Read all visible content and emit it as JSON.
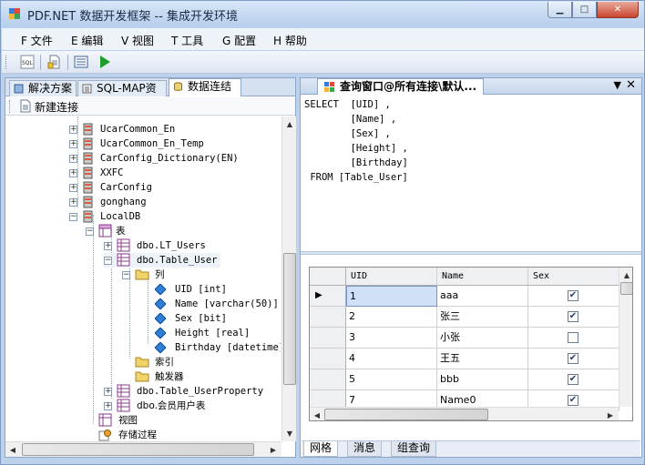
{
  "window": {
    "title": "PDF.NET 数据开发框架 -- 集成开发环境"
  },
  "menu": [
    {
      "key": "F",
      "label": "文件"
    },
    {
      "key": "E",
      "label": "编辑"
    },
    {
      "key": "V",
      "label": "视图"
    },
    {
      "key": "T",
      "label": "工具"
    },
    {
      "key": "G",
      "label": "配置"
    },
    {
      "key": "H",
      "label": "帮助"
    }
  ],
  "toolbar": {
    "icons": [
      "sql-icon",
      "new-document-icon",
      "list-icon",
      "run-icon"
    ]
  },
  "left_tabs": [
    {
      "label": "解决方案",
      "icon": "solution-icon"
    },
    {
      "label": "SQL-MAP资源",
      "icon": "sqlmap-icon"
    },
    {
      "label": "数据连结",
      "icon": "database-icon"
    }
  ],
  "new_connection_label": "新建连接",
  "tree": {
    "databases": [
      "UcarCommon_En",
      "UcarCommon_En_Temp",
      "CarConfig_Dictionary(EN)",
      "XXFC",
      "CarConfig",
      "gonghang",
      "LocalDB"
    ],
    "tables_node": "表",
    "tables": [
      "dbo.LT_Users",
      "dbo.Table_User",
      "dbo.Table_UserProperty",
      "dbo.会员用户表"
    ],
    "columns_node": "列",
    "columns": [
      "UID [int]",
      "Name [varchar(50)]",
      "Sex [bit]",
      "Height [real]",
      "Birthday [datetime]"
    ],
    "indexes_node": "索引",
    "triggers_node": "触发器",
    "views_node": "视图",
    "procs_node": "存储过程"
  },
  "query_tab": {
    "title": "查询窗口@所有连接\\默认..."
  },
  "sql_text": "SELECT  [UID] ,\n        [Name] ,\n        [Sex] ,\n        [Height] ,\n        [Birthday]\n FROM [Table_User]",
  "grid": {
    "columns": [
      "UID",
      "Name",
      "Sex"
    ],
    "rows": [
      {
        "uid": "1",
        "name": "aaa",
        "sex": true
      },
      {
        "uid": "2",
        "name": "张三",
        "sex": true
      },
      {
        "uid": "3",
        "name": "小张",
        "sex": false
      },
      {
        "uid": "4",
        "name": "王五",
        "sex": true
      },
      {
        "uid": "5",
        "name": "bbb",
        "sex": true
      },
      {
        "uid": "7",
        "name": "Name0",
        "sex": true
      }
    ]
  },
  "bottom_tabs": [
    "网格",
    "消息",
    "组查询"
  ],
  "colors": {
    "title_gradient": "#c2d7f1",
    "selection": "#cfe0f7",
    "accent": "#2c8a2c"
  }
}
